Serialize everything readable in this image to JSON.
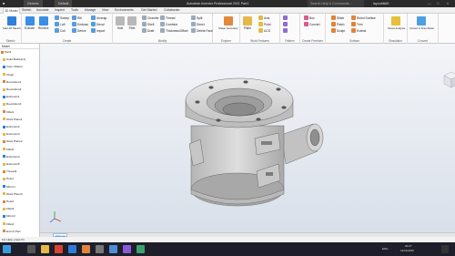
{
  "titlebar": {
    "appearance": "Default",
    "title": "Autodesk Inventor Professional 2021  Part1",
    "search_placeholder": "Search Help & Commands...",
    "user": "layoufdk69"
  },
  "tabs": [
    "3D Model",
    "Sketch",
    "Annotate",
    "Inspect",
    "Tools",
    "Manage",
    "View",
    "Environments",
    "Get Started",
    "Collaborate"
  ],
  "ribbon": {
    "sketch": {
      "label": "Sketch",
      "start": "Start 2D Sketch"
    },
    "create": {
      "label": "Create",
      "items": [
        "Extrude",
        "Revolve",
        "Sweep",
        "Loft",
        "Coil",
        "Rib",
        "Emboss",
        "Derive",
        "Unwrap",
        "Decal",
        "Import"
      ]
    },
    "modify": {
      "label": "Modify",
      "items": [
        "Hole",
        "Fillet",
        "Chamfer",
        "Shell",
        "Draft",
        "Thread",
        "Combine",
        "Thickness/Offset",
        "Split",
        "Direct",
        "Delete Face"
      ]
    },
    "explore": {
      "label": "Explore",
      "items": [
        "Shape Generator"
      ]
    },
    "work_features": {
      "label": "Work Features",
      "items": [
        "Plane",
        "Axis",
        "Point",
        "UCS"
      ]
    },
    "pattern": {
      "label": "Pattern"
    },
    "create_freeform": {
      "label": "Create Freeform",
      "items": [
        "Box",
        "Convert"
      ]
    },
    "surface": {
      "label": "Surface",
      "items": [
        "Stitch",
        "Patch",
        "Sculpt",
        "Ruled Surface",
        "Trim",
        "Extend"
      ]
    },
    "simulation": {
      "label": "Simulation",
      "items": [
        "Stress Analysis"
      ]
    },
    "convert": {
      "label": "Convert",
      "items": [
        "Convert to Sheet Metal"
      ]
    }
  },
  "browser": {
    "header": "Model",
    "nodes": [
      "Part1",
      "Solid Bodies(1)",
      "View: Master",
      "Origin",
      "Revolution1",
      "Revolution2",
      "Extrusion1",
      "Revolution3",
      "Fillet1",
      "Work Plane1",
      "Extrusion2",
      "Extrusion3",
      "Work Plane2",
      "Fillet2",
      "Extrusion4",
      "Extrusion5",
      "Thread1",
      "Hole1",
      "Mirror1",
      "Work Plane3",
      "Hole2",
      "Fillet3",
      "Mirror2",
      "Fillet4",
      "End of Part"
    ]
  },
  "document_tab": "Part1.ipt",
  "status": "For Help, press F1",
  "taskbar": {
    "lang": "ENG",
    "time": "20:27",
    "date": "12/11/2020"
  },
  "colors": {
    "accent": "#1f6fd1",
    "titlebar": "#2b2b2b",
    "viewport_top": "#f3f5f8",
    "viewport_bottom": "#d9e0ea",
    "part": "#c9c9c9"
  }
}
